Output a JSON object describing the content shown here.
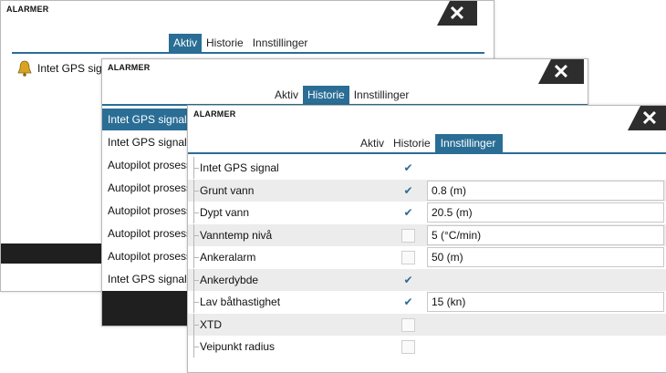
{
  "dialog1": {
    "title": "ALARMER",
    "close_glyph": "✕",
    "tabs": [
      "Aktiv",
      "Historie",
      "Innstillinger"
    ],
    "active_tab": "Aktiv",
    "items": [
      {
        "icon": "bell-warning-icon",
        "text": "Intet GPS signal"
      }
    ]
  },
  "dialog2": {
    "title": "ALARMER",
    "close_glyph": "✕",
    "tabs": [
      "Aktiv",
      "Historie",
      "Innstillinger"
    ],
    "active_tab": "Historie",
    "rows": [
      "Intet GPS signal ra",
      "Intet GPS signal ra",
      "Autopilot prosesso",
      "Autopilot prosesso",
      "Autopilot prosesso",
      "Autopilot prosesso",
      "Autopilot prosesso",
      "Intet GPS signal cl"
    ]
  },
  "dialog3": {
    "title": "ALARMER",
    "close_glyph": "✕",
    "tabs": [
      "Aktiv",
      "Historie",
      "Innstillinger"
    ],
    "active_tab": "Innstillinger",
    "check_glyph": "✔",
    "settings": [
      {
        "label": "Intet GPS signal",
        "checked": true,
        "value": null
      },
      {
        "label": "Grunt vann",
        "checked": true,
        "value": "0.8 (m)"
      },
      {
        "label": "Dypt vann",
        "checked": true,
        "value": "20.5 (m)"
      },
      {
        "label": "Vanntemp nivå",
        "checked": false,
        "value": "5 (°C/min)"
      },
      {
        "label": "Ankeralarm",
        "checked": false,
        "value": "50 (m)"
      },
      {
        "label": "Ankerdybde",
        "checked": true,
        "value": null
      },
      {
        "label": "Lav båthastighet",
        "checked": true,
        "value": "15 (kn)"
      },
      {
        "label": "XTD",
        "checked": false,
        "value": null
      },
      {
        "label": "Veipunkt radius",
        "checked": false,
        "value": null
      }
    ]
  },
  "colors": {
    "accent": "#2a6e96",
    "close_bg": "#2d2d2d",
    "footer": "#1f1f1f",
    "row_alt": "#ececec"
  }
}
